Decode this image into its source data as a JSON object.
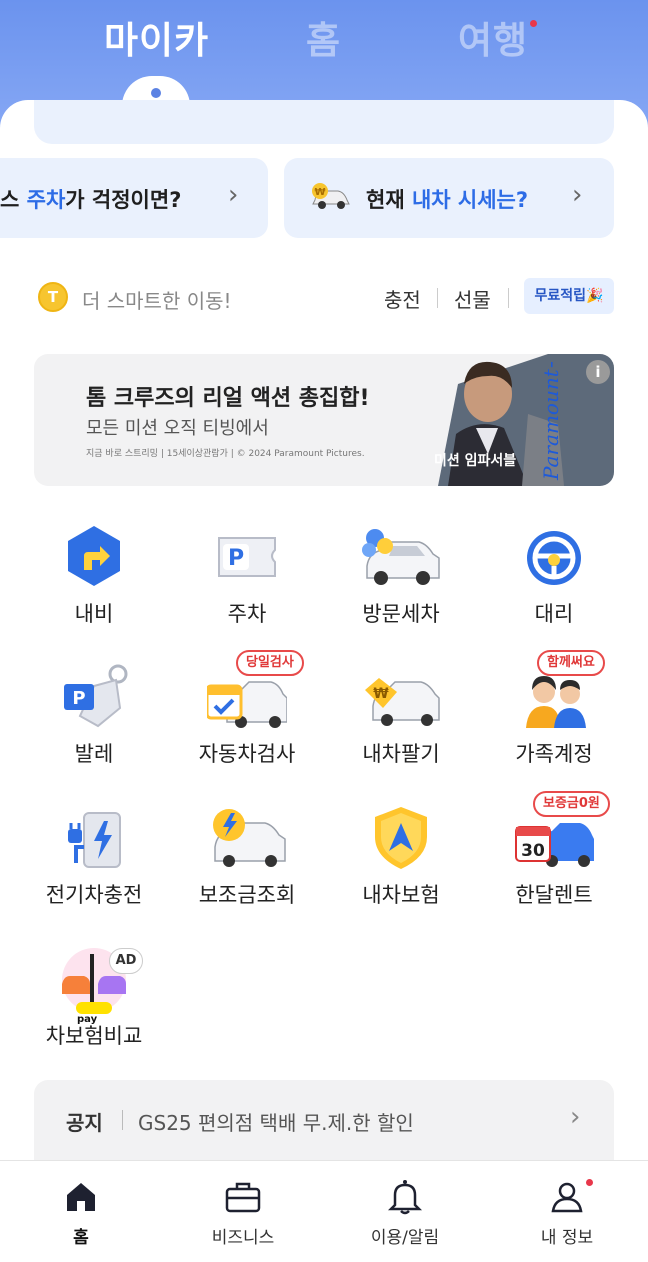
{
  "header": {
    "tabs": [
      {
        "label": "마이카",
        "active": true
      },
      {
        "label": "홈",
        "active": false
      },
      {
        "label": "여행",
        "active": false,
        "has_notification_dot": true
      }
    ]
  },
  "promos": {
    "left": {
      "prefix": "스 ",
      "highlight": "주차",
      "suffix": "가 걱정이면?"
    },
    "right": {
      "prefix": "현재 ",
      "highlight": "내차 시세는?",
      "suffix": ""
    }
  },
  "points": {
    "coin_letter": "T",
    "text": "더 스마트한 이동!",
    "link_charge": "충전",
    "link_gift": "선물",
    "free_button": "무료적립🎉"
  },
  "banner": {
    "title": "톰 크루즈의 리얼 액션 총집합!",
    "subtitle": "모든 미션 오직 티빙에서",
    "fine_print": "지금 바로 스트리밍 | 15세이상관람가 | © 2024 Paramount Pictures.",
    "poster_title": "미션 임파서블",
    "brand": "Paramount+",
    "info_icon": "i"
  },
  "services": [
    {
      "label": "내비",
      "icon": "navigation-icon",
      "tag": ""
    },
    {
      "label": "주차",
      "icon": "parking-ticket-icon",
      "tag": ""
    },
    {
      "label": "방문세차",
      "icon": "car-wash-icon",
      "tag": ""
    },
    {
      "label": "대리",
      "icon": "steering-wheel-icon",
      "tag": ""
    },
    {
      "label": "발레",
      "icon": "valet-key-icon",
      "tag": ""
    },
    {
      "label": "자동차검사",
      "icon": "car-inspection-icon",
      "tag": "당일검사"
    },
    {
      "label": "내차팔기",
      "icon": "sell-car-icon",
      "tag": ""
    },
    {
      "label": "가족계정",
      "icon": "family-icon",
      "tag": "함께써요"
    },
    {
      "label": "전기차충전",
      "icon": "ev-charger-icon",
      "tag": ""
    },
    {
      "label": "보조금조회",
      "icon": "subsidy-car-icon",
      "tag": ""
    },
    {
      "label": "내차보험",
      "icon": "insurance-shield-icon",
      "tag": ""
    },
    {
      "label": "한달렌트",
      "icon": "monthly-rent-icon",
      "tag": "보증금0원"
    },
    {
      "label": "차보험비교",
      "icon": "insurance-compare-icon",
      "tag": "",
      "ad_badge": "AD",
      "pay_badge": "pay"
    }
  ],
  "notice": {
    "label": "공지",
    "text": "GS25 편의점 택배 무.제.한 할인"
  },
  "bottom_nav": [
    {
      "label": "홈",
      "icon": "home-icon",
      "active": true
    },
    {
      "label": "비즈니스",
      "icon": "briefcase-icon",
      "active": false
    },
    {
      "label": "이용/알림",
      "icon": "bell-icon",
      "active": false
    },
    {
      "label": "내 정보",
      "icon": "person-icon",
      "active": false,
      "has_notification_dot": true
    }
  ],
  "colors": {
    "header_blue": "#6b93ee",
    "accent_blue": "#2d6ce6",
    "tag_red": "#e84a4a",
    "promo_bg": "#eaf1fd"
  }
}
